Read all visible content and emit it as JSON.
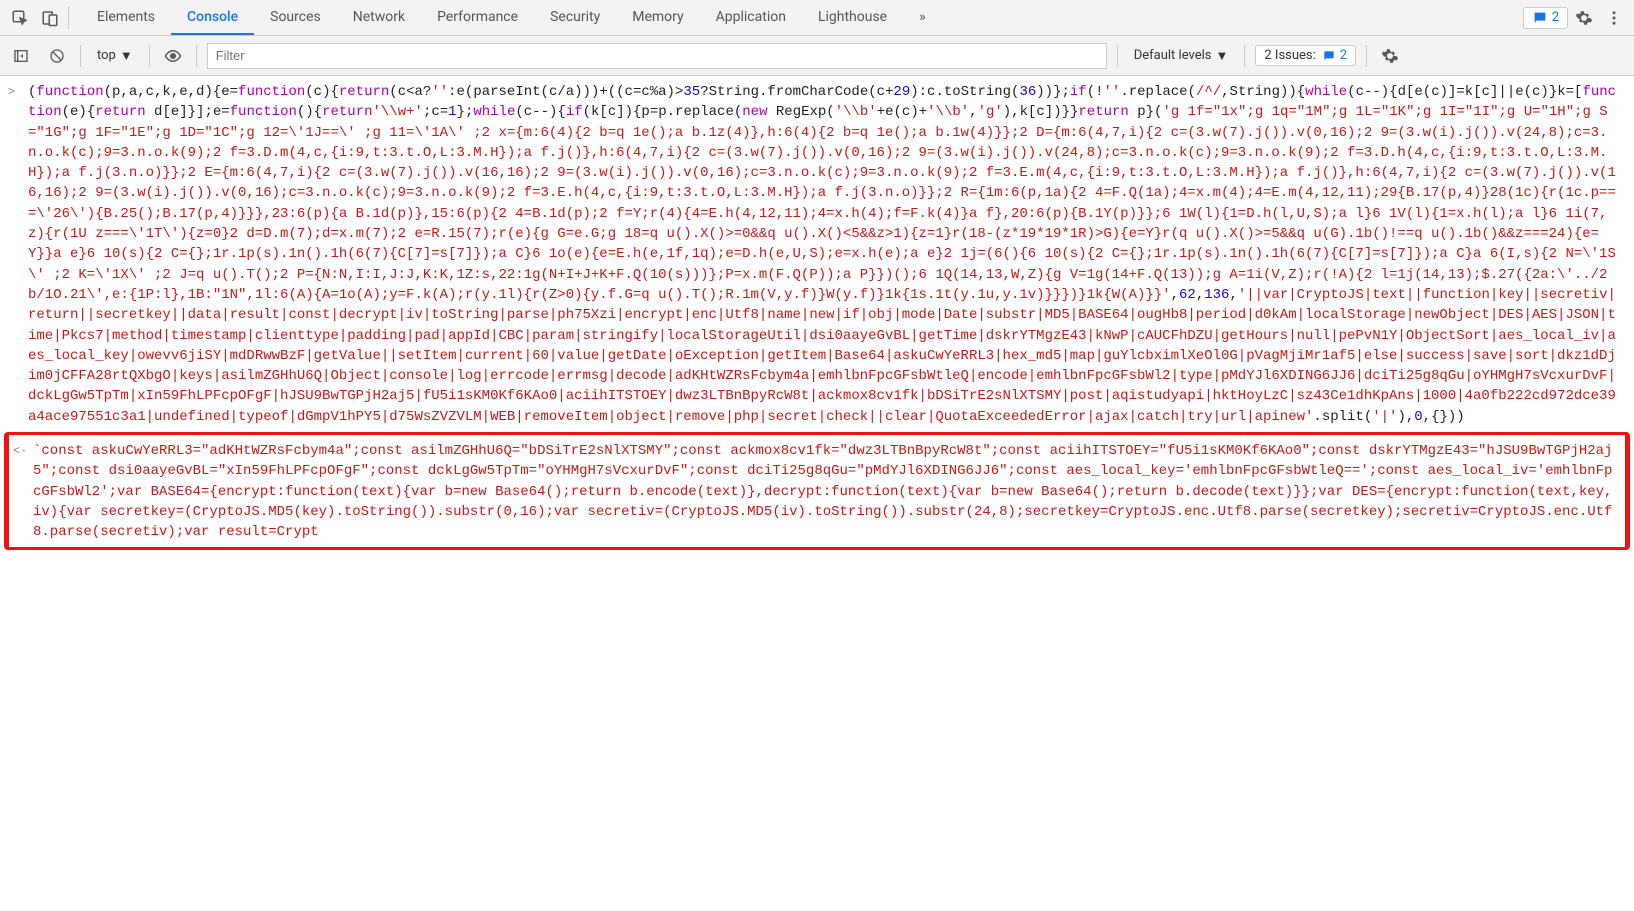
{
  "tabs": {
    "elements": "Elements",
    "console": "Console",
    "sources": "Sources",
    "network": "Network",
    "performance": "Performance",
    "security": "Security",
    "memory": "Memory",
    "application": "Application",
    "lighthouse": "Lighthouse"
  },
  "toolbar": {
    "errors_count": "2",
    "context": "top",
    "filter_placeholder": "Filter",
    "levels": "Default levels",
    "issues_label": "2 Issues:",
    "issues_count": "2"
  },
  "console": {
    "row1": {
      "gutter": ">",
      "p1": "(",
      "p2": "function",
      "p3": "(p,a,c,k,e,d){e=",
      "p4": "function",
      "p5": "(c){",
      "p6": "return",
      "p7": "(c<a?",
      "p8": "''",
      "p9": ":e(parseInt(c/a)))+((c=c%a)>",
      "p10": "35",
      "p11": "?String.fromCharCode(c+",
      "p12": "29",
      "p13": "):c.toString(",
      "p14": "36",
      "p15": "))};",
      "p16": "if",
      "p17": "(!",
      "p18": "''",
      "p19": ".replace(",
      "p20": "/^/",
      "p21": ",String)){",
      "p22": "while",
      "p23": "(c--){d[e(c)]=k[c]||e(c)}k=[",
      "p24": "function",
      "p25": "(e){",
      "p26": "return",
      "p27": " d[e]}];e=",
      "p28": "function",
      "p29": "(){",
      "p30": "return",
      "p31": "'\\\\w+'",
      "p32": ";c=",
      "p33": "1",
      "p34": "};",
      "p35": "while",
      "p36": "(c--){",
      "p37": "if",
      "p38": "(k[c]){p=p.replace(",
      "p39": "new",
      "p40": " RegExp(",
      "p41": "'\\\\b'",
      "p42": "+e(c)+",
      "p43": "'\\\\b'",
      "p44": ",",
      "p45": "'g'",
      "p46": "),k[c])}}",
      "p47": "return",
      "p48": " p}(",
      "bigstr": "'g 1f=\"1x\";g 1q=\"1M\";g 1L=\"1K\";g 1I=\"1I\";g U=\"1H\";g S=\"1G\";g 1F=\"1E\";g 1D=\"1C\";g 12=\\'1J==\\' ;g 11=\\'1A\\' ;2 x={m:6(4){2 b=q 1e();a b.1z(4)},h:6(4){2 b=q 1e();a b.1w(4)}};2 D={m:6(4,7,i){2 c=(3.w(7).j()).v(0,16);2 9=(3.w(i).j()).v(24,8);c=3.n.o.k(c);9=3.n.o.k(9);2 f=3.D.m(4,c,{i:9,t:3.t.O,L:3.M.H});a f.j()},h:6(4,7,i){2 c=(3.w(7).j()).v(0,16);2 9=(3.w(i).j()).v(24,8);c=3.n.o.k(c);9=3.n.o.k(9);2 f=3.D.h(4,c,{i:9,t:3.t.O,L:3.M.H});a f.j(3.n.o)}};2 E={m:6(4,7,i){2 c=(3.w(7).j()).v(16,16);2 9=(3.w(i).j()).v(0,16);c=3.n.o.k(c);9=3.n.o.k(9);2 f=3.E.m(4,c,{i:9,t:3.t.O,L:3.M.H});a f.j()},h:6(4,7,i){2 c=(3.w(7).j()).v(16,16);2 9=(3.w(i).j()).v(0,16);c=3.n.o.k(c);9=3.n.o.k(9);2 f=3.E.h(4,c,{i:9,t:3.t.O,L:3.M.H});a f.j(3.n.o)}};2 R={1m:6(p,1a){2 4=F.Q(1a);4=x.m(4);4=E.m(4,12,11);29{B.17(p,4)}28(1c){r(1c.p===\\'26\\'){B.25();B.17(p,4)}}},23:6(p){a B.1d(p)},15:6(p){2 4=B.1d(p);2 f=Y;r(4){4=E.h(4,12,11);4=x.h(4);f=F.k(4)}a f},20:6(p){B.1Y(p)}};6 1W(l){1=D.h(l,U,S);a l}6 1V(l){1=x.h(l);a l}6 1i(7,z){r(1U z===\\'1T\\'){z=0}2 d=D.m(7);d=x.m(7);2 e=R.15(7);r(e){g G=e.G;g 18=q u().X()>=0&&q u().X()<5&&z>1){z=1}r(18-(z*19*19*1R)>G){e=Y}r(q u().X()>=5&&q u(G).1b()!==q u().1b()&&z===24){e=Y}}a e}6 10(s){2 C={};1r.1p(s).1n().1h(6(7){C[7]=s[7]});a C}6 1o(e){e=E.h(e,1f,1q);e=D.h(e,U,S);e=x.h(e);a e}2 1j=(6(){6 10(s){2 C={};1r.1p(s).1n().1h(6(7){C[7]=s[7]});a C}a 6(I,s){2 N=\\'1S\\' ;2 K=\\'1X\\' ;2 J=q u().T();2 P={N:N,I:I,J:J,K:K,1Z:s,22:1g(N+I+J+K+F.Q(10(s)))};P=x.m(F.Q(P));a P}})();6 1Q(14,13,W,Z){g V=1g(14+F.Q(13));g A=1i(V,Z);r(!A){2 l=1j(14,13);$.27({2a:\\'../2b/1O.21\\',e:{1P:l},1B:\"1N\",1l:6(A){A=1o(A);y=F.k(A);r(y.1l){r(Z>0){y.f.G=q u().T();R.1m(V,y.f)}W(y.f)}1k{1s.1t(y.1u,y.1v)}}})}1k{W(A)}}'",
      "comma1": ",",
      "n62": "62",
      "comma2": ",",
      "n136": "136",
      "comma3": ",",
      "bigstr2": "'||var|CryptoJS|text||function|key||secretiv|return||secretkey||data|result|const|decrypt|iv|toString|parse|ph75Xzi|encrypt|enc|Utf8|name|new|if|obj|mode|Date|substr|MD5|BASE64|ougHb8|period|d0kAm|localStorage|newObject|DES|AES|JSON|time|Pkcs7|method|timestamp|clienttype|padding|pad|appId|CBC|param|stringify|localStorageUtil|dsi0aayeGvBL|getTime|dskrYTMgzE43|kNwP|cAUCFhDZU|getHours|null|pePvN1Y|ObjectSort|aes_local_iv|aes_local_key|owevv6jiSY|mdDRwwBzF|getValue||setItem|current|60|value|getDate|oException|getItem|Base64|askuCwYeRRL3|hex_md5|map|guYlcbximlXeOl0G|pVagMjiMr1af5|else|success|save|sort|dkz1dDjim0jCFFA28rtQXbgO|keys|asilmZGHhU6Q|Object|console|log|errcode|errmsg|decode|adKHtWZRsFcbym4a|emhlbnFpcGFsbWtleQ|encode|emhlbnFpcGFsbWl2|type|pMdYJl6XDING6JJ6|dciTi25g8qGu|oYHMgH7sVcxurDvF|dckLgGw5TpTm|xIn59FhLPFcpOFgF|hJSU9BwTGPjH2aj5|fU5i1sKM0Kf6KAo0|aciihITSTOEY|dwz3LTBnBpyRcW8t|ackmox8cv1fk|bDSiTrE2sNlXTSMY|post|aqistudyapi|hktHoyLzC|sz43Ce1dhKpAns|1000|4a0fb222cd972dce39a4ace97551c3a1|undefined|typeof|dGmpV1hPY5|d75WsZVZVLM|WEB|removeItem|object|remove|php|secret|check||clear|QuotaExceededError|ajax|catch|try|url|apinew'",
      "tail1": ".split(",
      "tail2": "'|'",
      "tail3": "),",
      "tail4": "0",
      "tail5": ",{}))"
    },
    "row2": {
      "gutter": "<·",
      "text1": "`const askuCwYeRRL3=\"adKHtWZRsFcbym4a\";const asilmZGHhU6Q=\"bDSiTrE2sNlXTSMY\";const ackmox8cv1fk=\"dwz3LTBnBpyRcW8t\";const aciihITSTOEY=\"fU5i1sKM0Kf6KAo0\";const dskrYTMgzE43=\"hJSU9BwTGPjH2aj5\";const dsi0aayeGvBL=\"xIn59FhLPFcpOFgF\";const dckLgGw5TpTm=\"oYHMgH7sVcxurDvF\";const dciTi25g8qGu=\"pMdYJl6XDING6JJ6\";const aes_local_key='emhlbnFpcGFsbWtleQ==';const aes_local_iv='emhlbnFpcGFsbWl2';var BASE64={encrypt:function(text){var b=new Base64();return b.encode(text)},decrypt:function(text){var b=new Base64();return b.decode(text)}};var DES={encrypt:function(text,key,iv){var secretkey=(CryptoJS.MD5(key).toString()).substr(0,16);var secretiv=(CryptoJS.MD5(iv).toString()).substr(24,8);secretkey=CryptoJS.enc.Utf8.parse(secretkey);secretiv=CryptoJS.enc.Utf8.parse(secretiv);var result=Crypt"
    }
  }
}
